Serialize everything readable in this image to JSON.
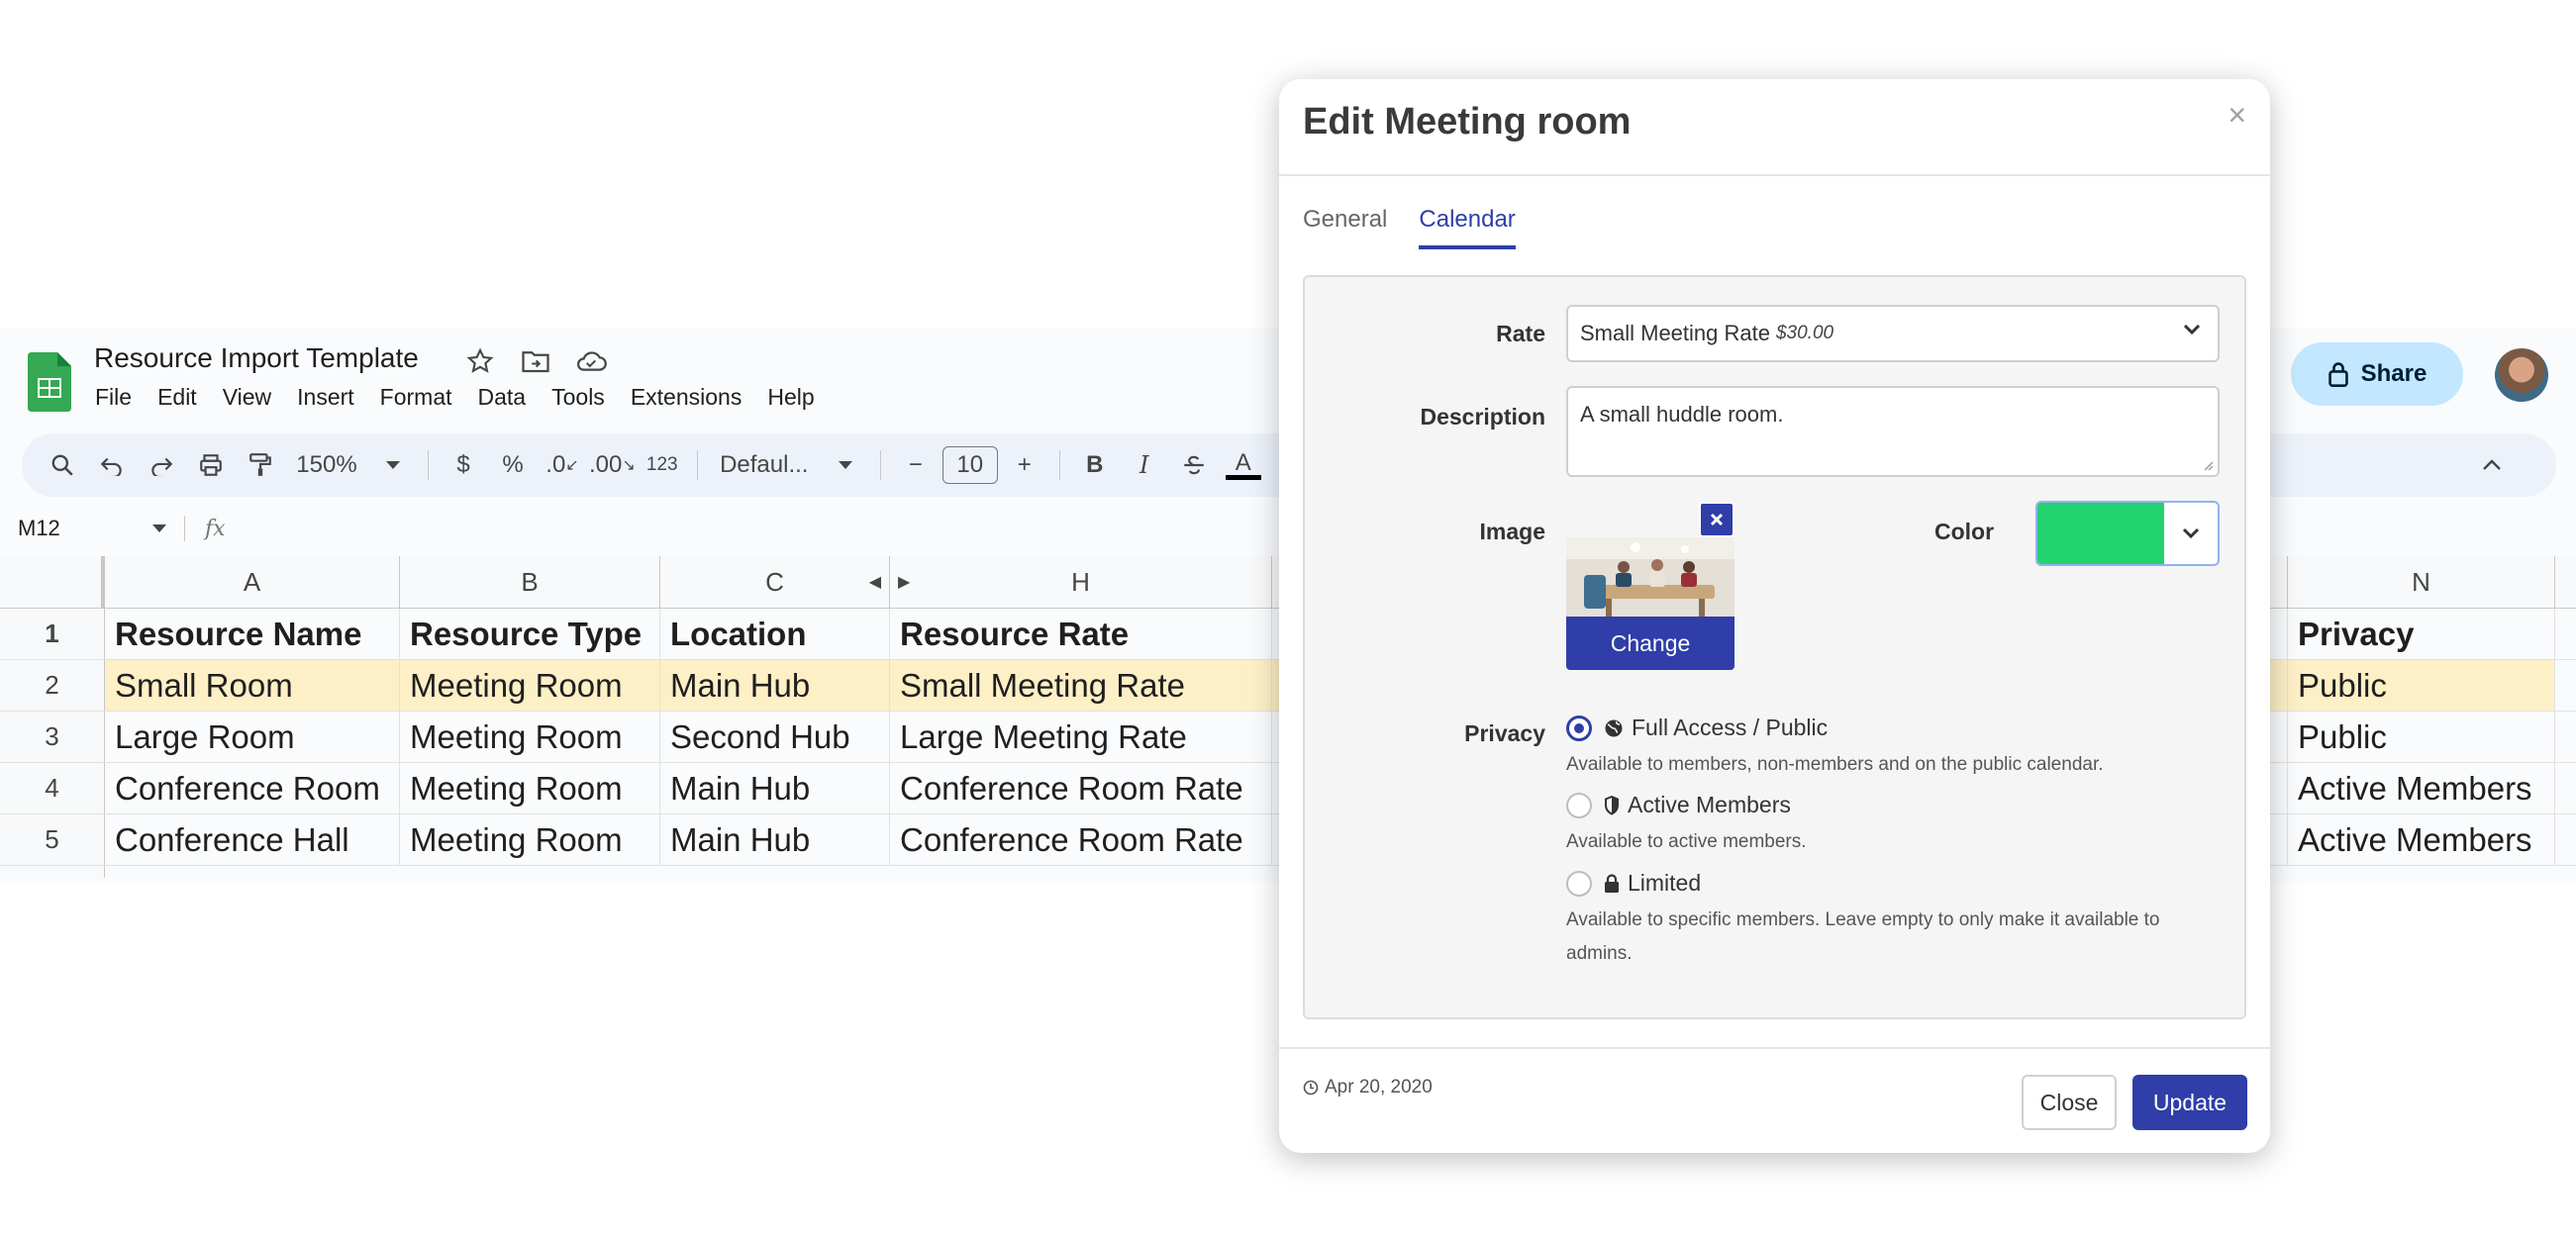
{
  "sheets": {
    "title": "Resource Import Template",
    "menu": [
      "File",
      "Edit",
      "View",
      "Insert",
      "Format",
      "Data",
      "Tools",
      "Extensions",
      "Help"
    ],
    "share_label": "Share",
    "toolbar": {
      "zoom": "150%",
      "currency": "$",
      "percent": "%",
      "dec_decrease": ".0",
      "dec_increase": ".00",
      "number_format": "123",
      "font": "Defaul...",
      "minus": "−",
      "font_size": "10",
      "plus": "+",
      "bold": "B",
      "italic": "I",
      "text_color": "A"
    },
    "name_box": "M12",
    "fx": "fx",
    "columns": [
      "A",
      "B",
      "C",
      "H",
      "N"
    ],
    "rows": [
      {
        "num": "1",
        "cells": [
          "Resource Name",
          "Resource Type",
          "Location",
          "Resource Rate",
          "Privacy"
        ]
      },
      {
        "num": "2",
        "cells": [
          "Small Room",
          "Meeting Room",
          "Main Hub",
          "Small Meeting Rate",
          "Public"
        ]
      },
      {
        "num": "3",
        "cells": [
          "Large Room",
          "Meeting Room",
          "Second Hub",
          "Large Meeting Rate",
          "Public"
        ]
      },
      {
        "num": "4",
        "cells": [
          "Conference Room",
          "Meeting Room",
          "Main Hub",
          "Conference Room Rate",
          "Active Members"
        ]
      },
      {
        "num": "5",
        "cells": [
          "Conference Hall",
          "Meeting Room",
          "Main Hub",
          "Conference Room Rate",
          "Active Members"
        ]
      }
    ],
    "colors": {
      "highlight_row": "#fdefc6",
      "share_bg": "#c2e7ff"
    }
  },
  "modal": {
    "title": "Edit Meeting room",
    "close_glyph": "×",
    "tabs": [
      "General",
      "Calendar"
    ],
    "active_tab": "Calendar",
    "rate": {
      "label": "Rate",
      "value": "Small Meeting Rate",
      "price": "$30.00"
    },
    "description": {
      "label": "Description",
      "value": "A small huddle room."
    },
    "image": {
      "label": "Image",
      "change_label": "Change"
    },
    "color": {
      "label": "Color",
      "value": "#22d36e"
    },
    "privacy": {
      "label": "Privacy",
      "options": [
        {
          "label": "Full Access / Public",
          "help": "Available to members, non-members and on the public calendar.",
          "selected": true,
          "icon": "globe-icon"
        },
        {
          "label": "Active Members",
          "help": "Available to active members.",
          "selected": false,
          "icon": "shield-icon"
        },
        {
          "label": "Limited",
          "help": "Available to specific members. Leave empty to only make it available to admins.",
          "selected": false,
          "icon": "lock-icon"
        }
      ]
    },
    "footer": {
      "date": "Apr 20, 2020",
      "close_label": "Close",
      "update_label": "Update"
    },
    "accent": "#2f3ea8"
  }
}
